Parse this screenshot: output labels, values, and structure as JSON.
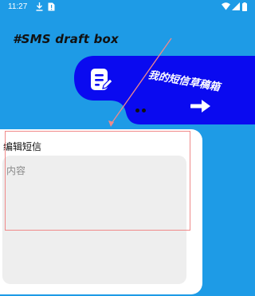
{
  "status_bar": {
    "time": "11:27",
    "left_icons": [
      "download-icon",
      "sim-alert-icon"
    ],
    "right_icons": [
      "wifi-icon",
      "signal-icon",
      "battery-icon"
    ]
  },
  "header": {
    "title": "#SMS draft box"
  },
  "banner": {
    "caption": "我的短信草稿箱",
    "icons": [
      "note-edit-icon",
      "arrow-right-icon"
    ],
    "page_count": 2,
    "colors": {
      "banner": "#0a0af0",
      "background": "#1e9be6",
      "highlight": "#f08a8a"
    }
  },
  "editor": {
    "title": "编辑短信",
    "input_value": "",
    "input_placeholder": "内容"
  }
}
